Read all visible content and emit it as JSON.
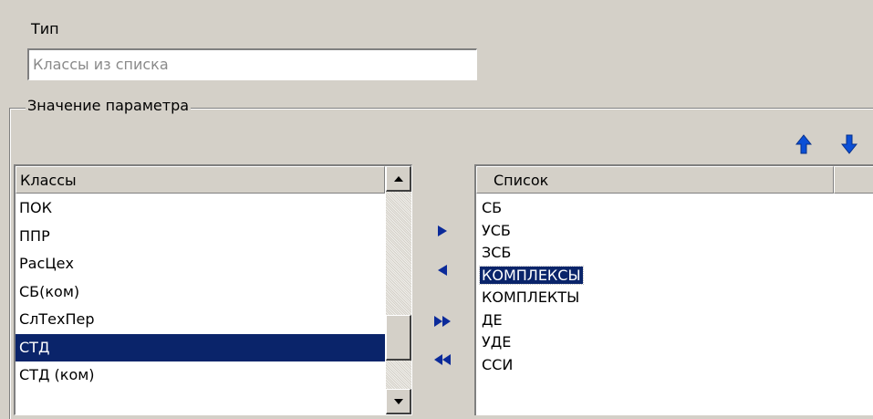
{
  "type_section": {
    "label": "Тип",
    "value": "Классы из списка"
  },
  "group": {
    "title": "Значение параметра"
  },
  "order_buttons": {
    "up_icon": "arrow-up-icon",
    "down_icon": "arrow-down-icon",
    "color": "#0b4fd6"
  },
  "left_list": {
    "header": "Классы",
    "items": [
      "ПОК",
      "ППР",
      "РасЦех",
      "СБ(ком)",
      "СлТехПер",
      "СТД",
      "СТД (ком)"
    ],
    "selected_index": 5
  },
  "transfer_buttons": {
    "add_icon": "arrow-right-icon",
    "remove_icon": "arrow-left-icon",
    "add_all_icon": "double-arrow-right-icon",
    "remove_all_icon": "double-arrow-left-icon",
    "color": "#0b2a9a"
  },
  "right_list": {
    "header": "Список",
    "items": [
      "СБ",
      "УСБ",
      "ЗСБ",
      "КОМПЛЕКСЫ",
      "КОМПЛЕКТЫ",
      "ДЕ",
      "УДЕ",
      "ССИ"
    ],
    "selected_index": 3
  },
  "colors": {
    "panel": "#d4d0c8",
    "selection": "#0a246a"
  }
}
